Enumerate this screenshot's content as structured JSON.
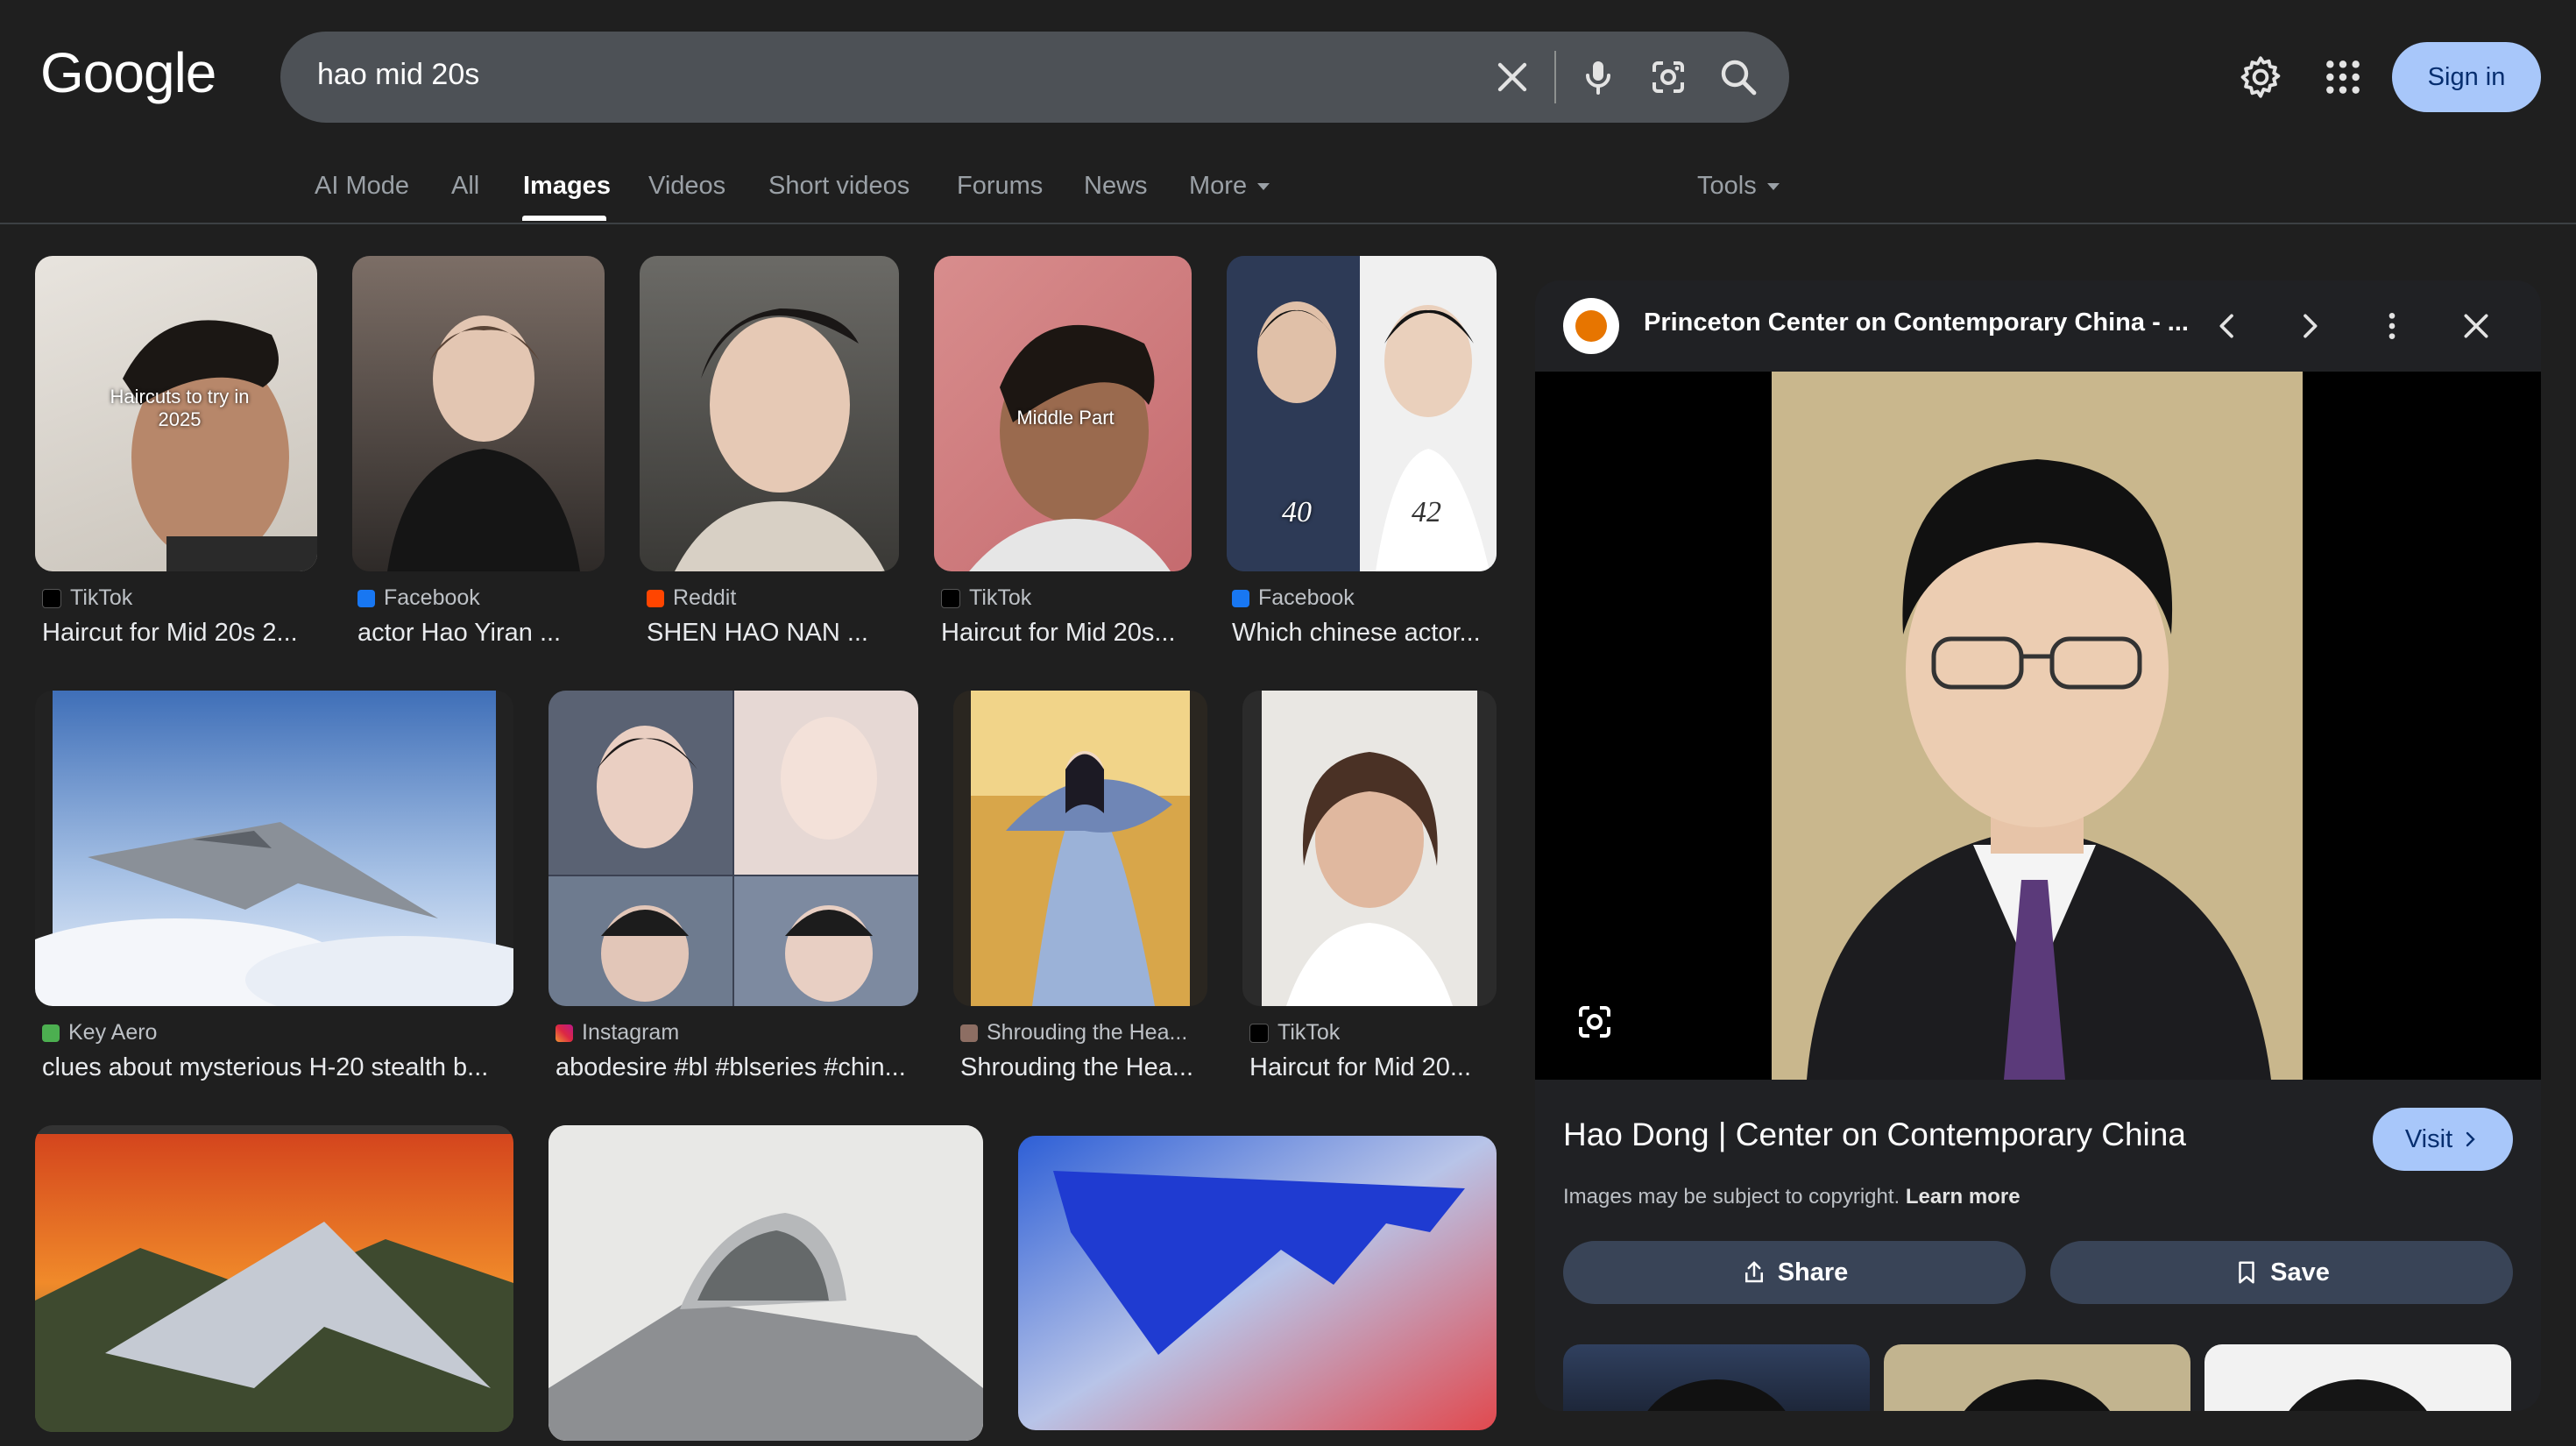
{
  "header": {
    "logo": "Google",
    "search_value": "hao mid 20s",
    "signin_label": "Sign in"
  },
  "tabs": [
    {
      "label": "AI Mode"
    },
    {
      "label": "All"
    },
    {
      "label": "Images"
    },
    {
      "label": "Videos"
    },
    {
      "label": "Short videos"
    },
    {
      "label": "Forums"
    },
    {
      "label": "News"
    },
    {
      "label": "More"
    }
  ],
  "tools_label": "Tools",
  "results": [
    {
      "source": "TikTok",
      "title": "Haircut for Mid 20s 2...",
      "overlay": "Haircuts to try in 2025"
    },
    {
      "source": "Facebook",
      "title": "actor Hao Yiran ..."
    },
    {
      "source": "Reddit",
      "title": "SHEN HAO NAN ..."
    },
    {
      "source": "TikTok",
      "title": "Haircut for Mid 20s...",
      "overlay": "Middle Part"
    },
    {
      "source": "Facebook",
      "title": "Which chinese actor...",
      "overlay_left": "40",
      "overlay_right": "42"
    },
    {
      "source": "Key Aero",
      "title": "clues about mysterious H-20 stealth b..."
    },
    {
      "source": "Instagram",
      "title": "abodesire #bl #blseries #chin..."
    },
    {
      "source": "Shrouding the Hea...",
      "title": "Shrouding the Hea..."
    },
    {
      "source": "TikTok",
      "title": "Haircut for Mid 20..."
    }
  ],
  "panel": {
    "site": "Princeton Center on Contemporary China - ...",
    "title": "Hao Dong | Center on Contemporary China",
    "visit_label": "Visit",
    "copyright_text": "Images may be subject to copyright.",
    "learn_more": "Learn more",
    "share_label": "Share",
    "save_label": "Save"
  },
  "colors": {
    "background": "#1f1f1f",
    "accent": "#a8c7fa",
    "button_dark": "#394457"
  }
}
